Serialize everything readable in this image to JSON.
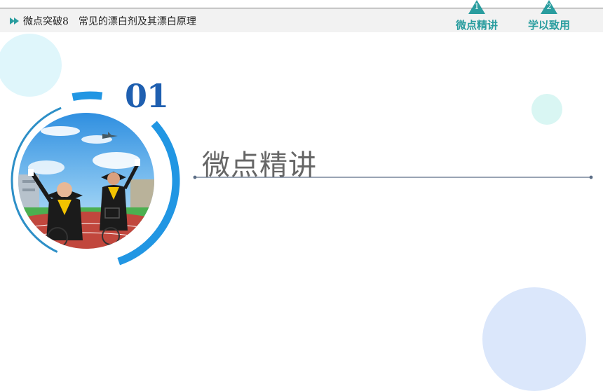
{
  "header": {
    "course": "微点突破8",
    "topic": "常见的漂白剂及其漂白原理"
  },
  "nav": [
    {
      "number": "1",
      "label": "微点精讲"
    },
    {
      "number": "2",
      "label": "学以致用"
    }
  ],
  "section": {
    "number": "01",
    "title": "微点精讲"
  },
  "colors": {
    "accent_teal": "#2a9d9f",
    "ring_blue": "#2196e3",
    "number_blue": "#1f5fb0"
  }
}
